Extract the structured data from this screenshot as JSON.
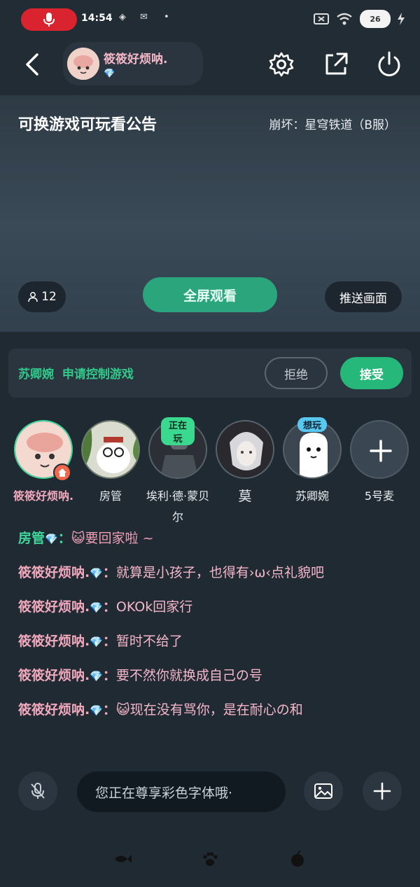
{
  "status_bar": {
    "time": "14:54",
    "battery": "26"
  },
  "header": {
    "user_name": "筱筱好烦呐.",
    "gem": "💎"
  },
  "video": {
    "title": "可换游戏可玩看公告",
    "game": "崩坏：星穹铁道（B服）",
    "viewer_count": "12",
    "fullscreen_label": "全屏观看",
    "push_label": "推送画面"
  },
  "request": {
    "requester": "苏卿婉",
    "text": "申请控制游戏",
    "reject_label": "拒绝",
    "accept_label": "接受"
  },
  "seats": [
    {
      "label": "筱筱好烦呐."
    },
    {
      "label": "房管"
    },
    {
      "label": "埃利·德·蒙贝尔",
      "badge": "正在玩"
    },
    {
      "label": "莫"
    },
    {
      "label": "苏卿婉",
      "badge": "想玩"
    },
    {
      "label": "5号麦"
    }
  ],
  "chat": [
    {
      "who": "房管",
      "gem": "💎",
      "sep": "：",
      "msg": "😺要回家啦 ~"
    },
    {
      "who": "筱筱好烦呐.",
      "gem": "💎",
      "sep": "：",
      "msg": "就算是小孩子，也得有›ω‹点礼貌吧"
    },
    {
      "who": "筱筱好烦呐.",
      "gem": "💎",
      "sep": "：",
      "msg": "OKOk回家行"
    },
    {
      "who": "筱筱好烦呐.",
      "gem": "💎",
      "sep": "：",
      "msg": "暂时不给了"
    },
    {
      "who": "筱筱好烦呐.",
      "gem": "💎",
      "sep": "：",
      "msg": "要不然你就换成自己の号"
    },
    {
      "who": "筱筱好烦呐.",
      "gem": "💎",
      "sep": "：",
      "msg": "😺现在没有骂你，是在耐心の和"
    }
  ],
  "input": {
    "placeholder": "您正在尊享彩色字体哦·"
  },
  "colors": {
    "accent_green": "#2aa57c",
    "name_pink": "#f3a9bd",
    "record_red": "#d9232e"
  }
}
